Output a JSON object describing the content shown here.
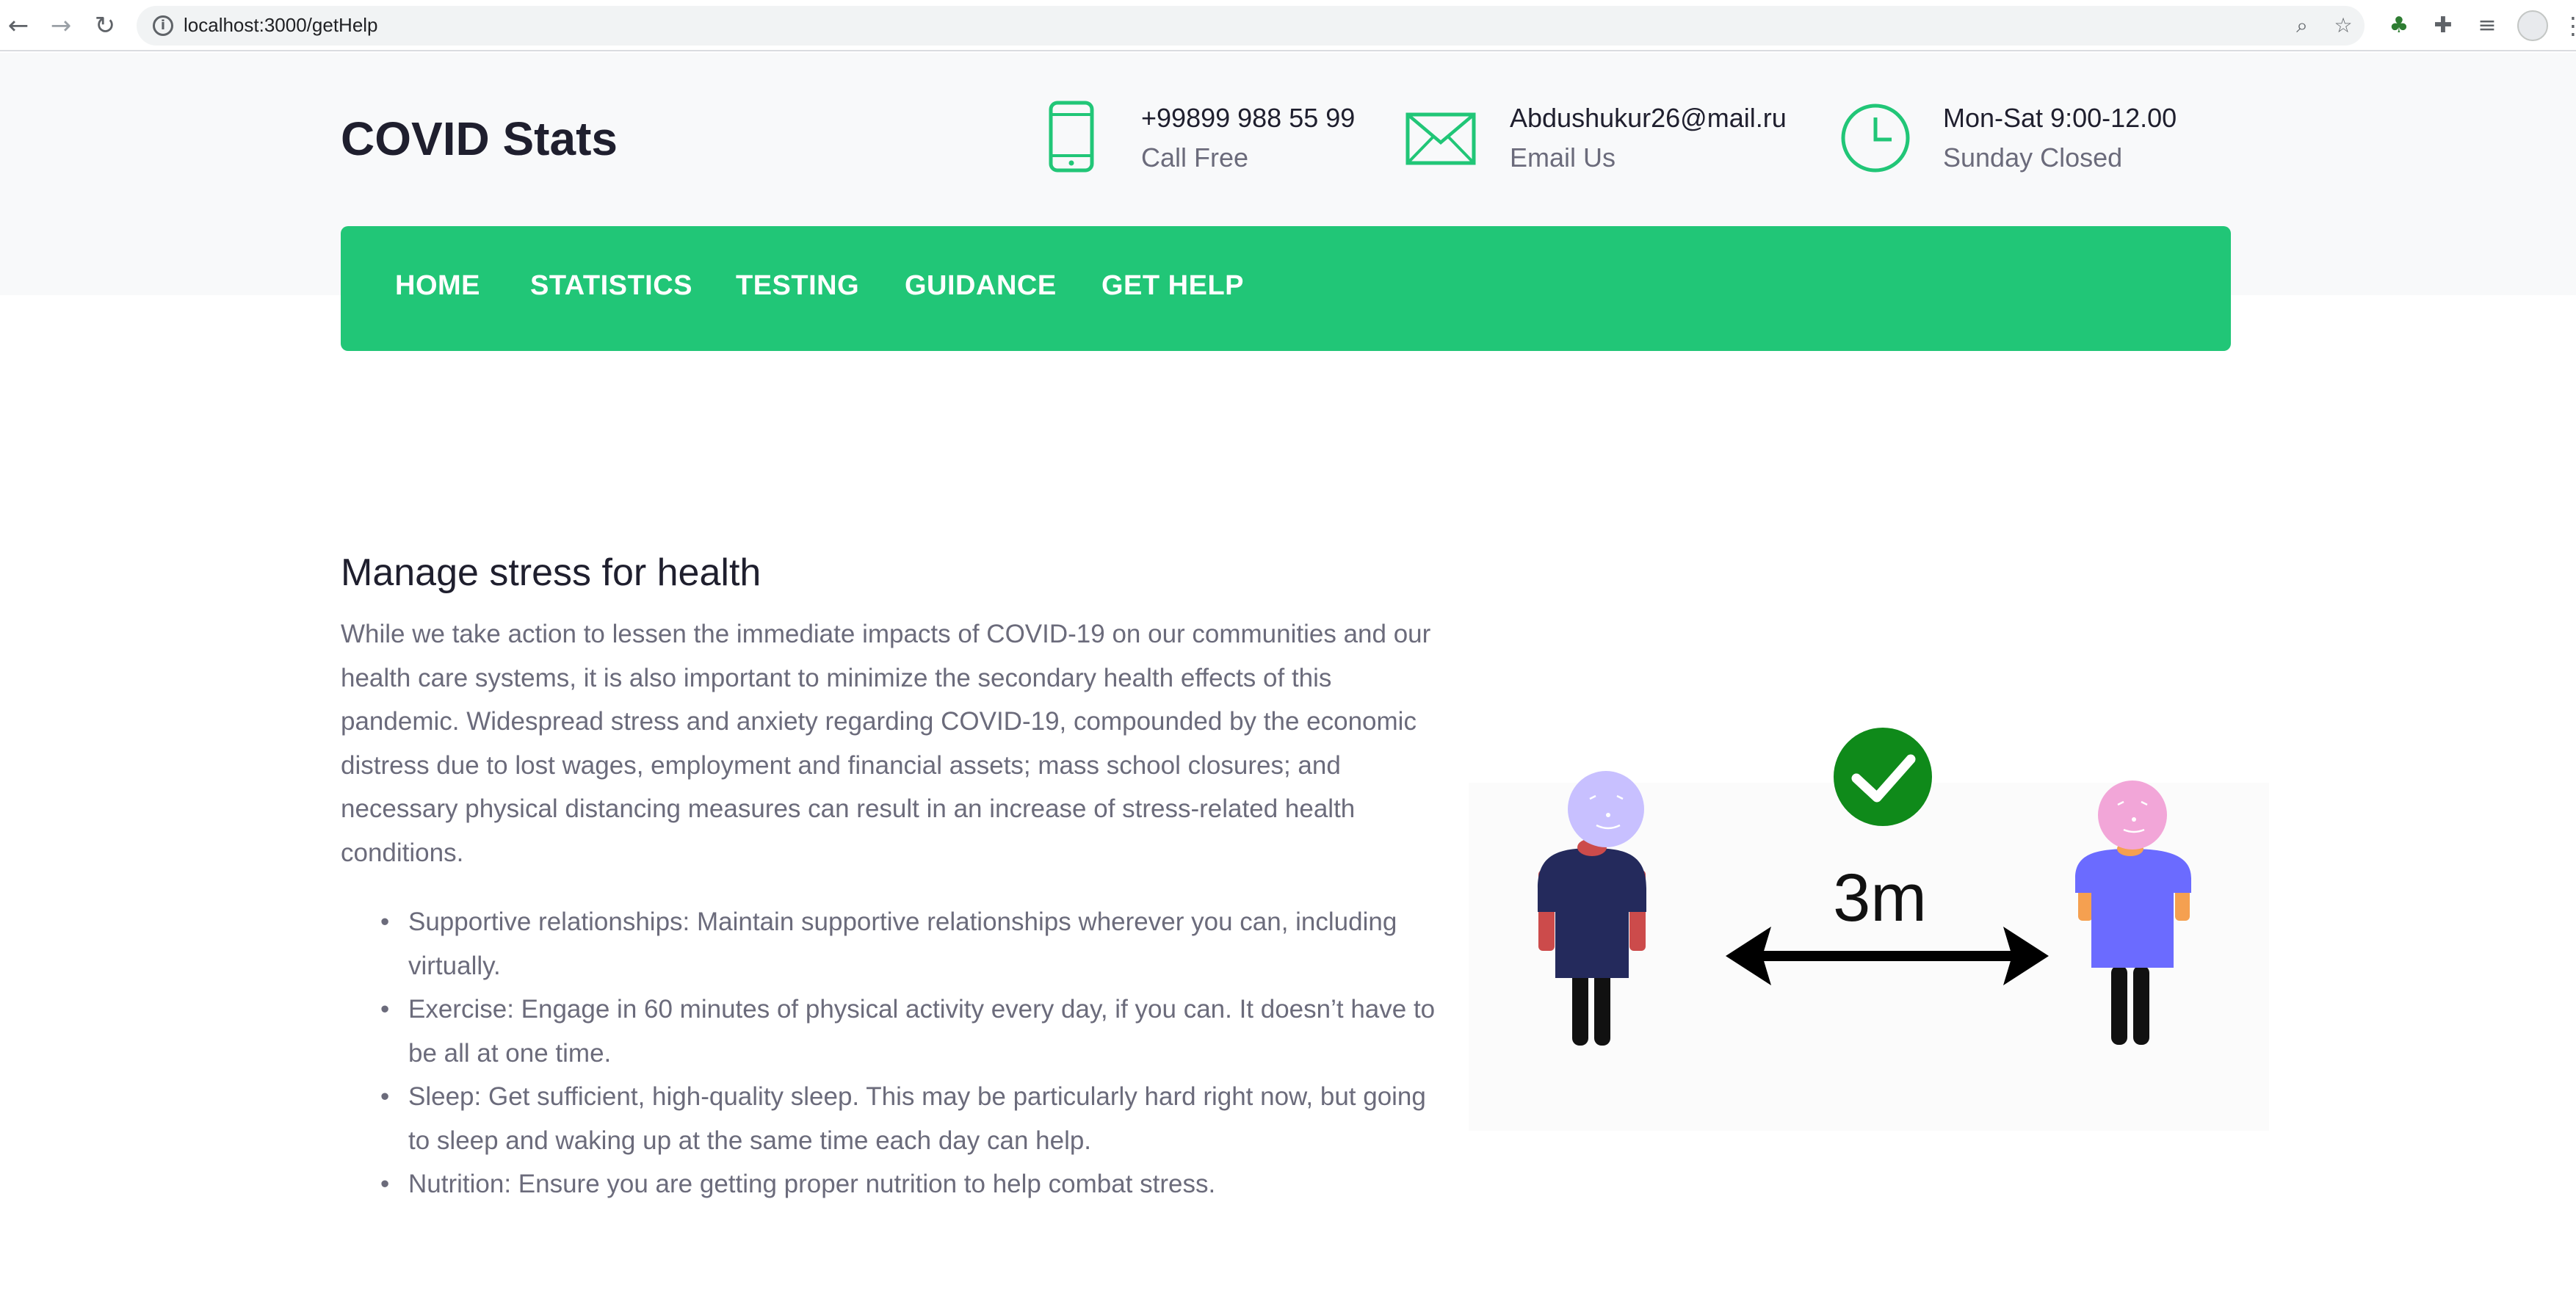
{
  "browser": {
    "url": "localhost:3000/getHelp"
  },
  "header": {
    "brand": "COVID Stats",
    "contacts": [
      {
        "icon": "phone-icon",
        "line1": "+99899 988 55 99",
        "line2": "Call Free"
      },
      {
        "icon": "envelope-icon",
        "line1": "Abdushukur26@mail.ru",
        "line2": "Email Us"
      },
      {
        "icon": "clock-icon",
        "line1": "Mon-Sat 9:00-12.00",
        "line2": "Sunday Closed"
      }
    ]
  },
  "nav": {
    "items": [
      "HOME",
      "STATISTICS",
      "TESTING",
      "GUIDANCE",
      "GET HELP"
    ],
    "color": "#21c677"
  },
  "main": {
    "heading": "Manage stress for health",
    "paragraph": "While we take action to lessen the immediate impacts of COVID-19 on our communities and our health care systems, it is also important to minimize the secondary health effects of this pandemic. Widespread stress and anxiety regarding COVID-19, compounded by the economic distress due to lost wages, employment and financial assets; mass school closures; and necessary physical distancing measures can result in an increase of stress-related health conditions.",
    "tips": [
      "Supportive relationships: Maintain supportive relationships wherever you can, including virtually.",
      "Exercise: Engage in 60 minutes of physical activity every day, if you can. It doesn’t have to be all at one time.",
      "Sleep: Get sufficient, high-quality sleep. This may be particularly hard right now, but going to sleep and waking up at the same time each day can help.",
      "Nutrition: Ensure you are getting proper nutrition to help combat stress."
    ],
    "illustration": {
      "distance_label": "3m"
    }
  }
}
